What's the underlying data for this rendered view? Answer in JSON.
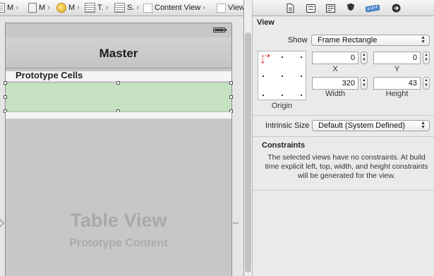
{
  "jumpbar": {
    "crumbs": [
      {
        "label": "M",
        "icon": "file-icon"
      },
      {
        "label": "M",
        "icon": "storyboard-file-icon"
      },
      {
        "label": "M",
        "icon": "scene-icon"
      },
      {
        "label": "T.",
        "icon": "table-view-controller-icon"
      },
      {
        "label": "S.",
        "icon": "table-view-icon"
      },
      {
        "label": "Content View",
        "icon": "view-icon"
      },
      {
        "label": "View",
        "icon": "view-icon"
      }
    ]
  },
  "canvas": {
    "nav_title": "Master",
    "section_header": "Prototype Cells",
    "placeholder_title": "Table View",
    "placeholder_subtitle": "Prototype Content",
    "selection_color": "#c6e2c3"
  },
  "inspector": {
    "tabs": [
      "file-inspector-icon",
      "quick-help-icon",
      "identity-inspector-icon",
      "attributes-inspector-icon",
      "size-inspector-icon",
      "connections-inspector-icon"
    ],
    "section_title": "View",
    "show_label": "Show",
    "show_value": "Frame Rectangle",
    "x_value": "0",
    "y_value": "0",
    "width_value": "320",
    "height_value": "43",
    "x_label": "X",
    "y_label": "Y",
    "width_label": "Width",
    "height_label": "Height",
    "origin_label": "Origin",
    "intrinsic_label": "Intrinsic Size",
    "intrinsic_value": "Default (System Defined)",
    "constraints_title": "Constraints",
    "constraints_text": "The selected views have no constraints. At build time explicit left, top, width, and height constraints will be generated for the view."
  }
}
